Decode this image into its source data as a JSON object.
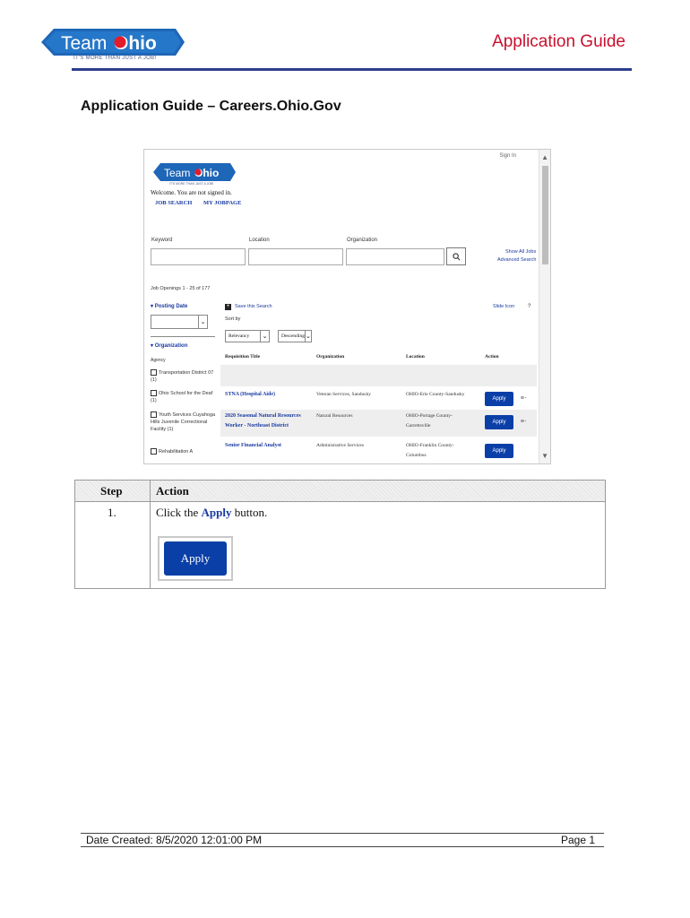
{
  "header": {
    "logo_team": "Team",
    "logo_ohio": "Ohio",
    "tagline": "IT'S MORE THAN JUST A JOB!",
    "guide_title": "Application Guide",
    "accent_color": "#c8102e",
    "rule_color": "#2d3f8c"
  },
  "page_heading": "Application Guide – Careers.Ohio.Gov",
  "screenshot": {
    "logo_team": "Team",
    "logo_ohio": "Ohio",
    "tagline": "IT'S MORE THAN JUST A JOB!",
    "sign_in": "Sign In",
    "welcome": "Welcome. You are not signed in.",
    "nav_job_search": "JOB SEARCH",
    "nav_my_jobpage": "MY JOBPAGE",
    "label_keyword": "Keyword",
    "label_location": "Location",
    "label_organization": "Organization",
    "link_show_all": "Show All Jobs",
    "link_advanced": "Advanced Search",
    "openings": "Job Openings 1 - 25 of 177",
    "posting_date": "Posting Date",
    "save_search": "Save this Search",
    "sort_by": "Sort by",
    "sort_value": "Relevancy",
    "sort_dir": "Descending",
    "organization_filter": "Organization",
    "agency": "Agency",
    "filters": [
      "Transportation District 07 (1)",
      "Ohio School for the Deaf (1)",
      "Youth Services Cuyahoga Hills Juvenile Correctional Facility (1)",
      "Rehabilitation A"
    ],
    "slide_link": "Slide Icon",
    "help": "?",
    "columns": [
      "Requisition Title",
      "Organization",
      "Location",
      "Action"
    ],
    "rows": [
      {
        "title": "STNA (Hospital Aide)",
        "org": "Veteran Services, Sandusky",
        "loc": "OHIO-Erie County-Sandusky",
        "action": "Apply"
      },
      {
        "title": "2020 Seasonal Natural Resources Worker - Northeast District",
        "org": "Natural Resources",
        "loc": "OHIO-Portage County-Garrettsville",
        "action": "Apply"
      },
      {
        "title": "Senior Financial Analyst",
        "org": "Administrative Services",
        "loc": "OHIO-Franklin County-Columbus",
        "action": "Apply"
      }
    ]
  },
  "steps_table": {
    "col_step": "Step",
    "col_action": "Action",
    "step_number": "1.",
    "instruction_pre": "Click the ",
    "instruction_bold": "Apply",
    "instruction_post": " button.",
    "button_label": "Apply"
  },
  "footer": {
    "date_created": "Date Created: 8/5/2020 12:01:00 PM",
    "page": "Page 1"
  }
}
